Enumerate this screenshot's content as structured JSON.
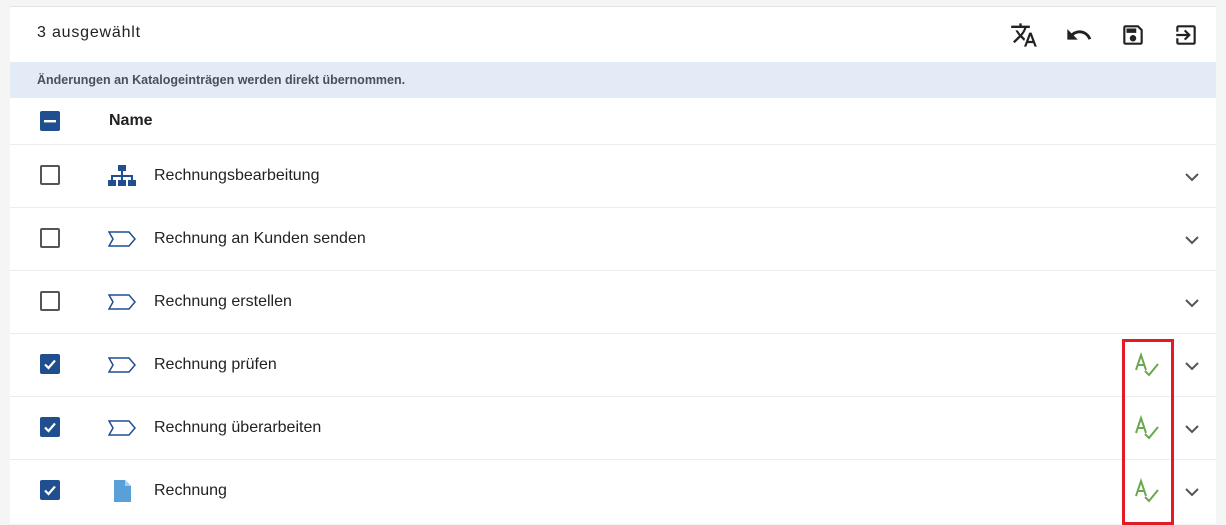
{
  "toolbar": {
    "selection_text": "3 ausgewählt",
    "buttons": [
      {
        "name": "translate-button",
        "icon": "translate-icon"
      },
      {
        "name": "undo-button",
        "icon": "undo-icon"
      },
      {
        "name": "save-button",
        "icon": "save-icon"
      },
      {
        "name": "exit-button",
        "icon": "exit-icon"
      }
    ]
  },
  "banner": {
    "text": "Änderungen an Katalogeinträgen werden direkt übernommen."
  },
  "list": {
    "header": {
      "name_label": "Name",
      "select_all_state": "indeterminate"
    },
    "rows": [
      {
        "label": "Rechnungsbearbeitung",
        "icon": "org-chart-icon",
        "checked": false,
        "spellcheck": false
      },
      {
        "label": "Rechnung an Kunden senden",
        "icon": "process-step-icon",
        "checked": false,
        "spellcheck": false
      },
      {
        "label": "Rechnung erstellen",
        "icon": "process-step-icon",
        "checked": false,
        "spellcheck": false
      },
      {
        "label": "Rechnung prüfen",
        "icon": "process-step-icon",
        "checked": true,
        "spellcheck": true
      },
      {
        "label": "Rechnung überarbeiten",
        "icon": "process-step-icon",
        "checked": true,
        "spellcheck": true
      },
      {
        "label": "Rechnung",
        "icon": "document-icon",
        "checked": true,
        "spellcheck": true
      }
    ]
  },
  "colors": {
    "accent": "#1f4f8f",
    "banner_bg": "#e3ecf6",
    "spellcheck_green": "#6aa84f",
    "highlight_red": "#e21b24",
    "document_icon": "#5aa0d8"
  }
}
